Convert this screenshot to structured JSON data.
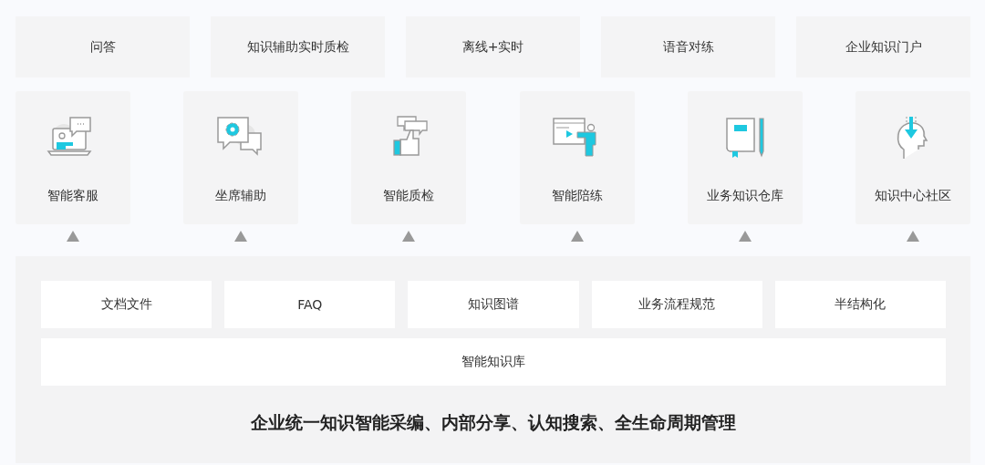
{
  "top_features": [
    "问答",
    "知识辅助实时质检",
    "离线+实时",
    "语音对练",
    "企业知识门户"
  ],
  "applications": [
    {
      "kind": "laptop-chat",
      "label": "智能客服"
    },
    {
      "kind": "gear-chat",
      "label": "坐席辅助"
    },
    {
      "kind": "thumb-chat",
      "label": "智能质检"
    },
    {
      "kind": "presenter",
      "label": "智能陪练"
    },
    {
      "kind": "book",
      "label": "业务知识仓库"
    },
    {
      "kind": "head",
      "label": "知识中心社区"
    }
  ],
  "sources": [
    "文档文件",
    "FAQ",
    "知识图谱",
    "业务流程规范",
    "半结构化"
  ],
  "knowledge_base": "智能知识库",
  "tagline": "企业统一知识智能采编、内部分享、认知搜索、全生命周期管理"
}
